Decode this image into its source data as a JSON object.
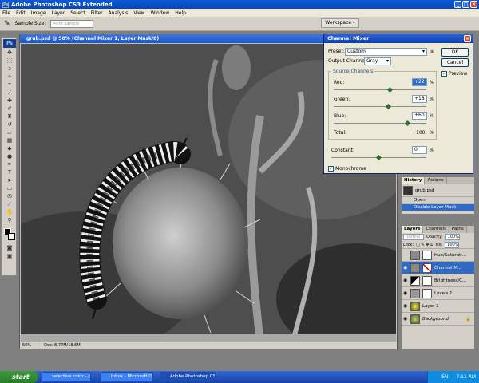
{
  "app": {
    "title": "Adobe Photoshop CS3 Extended"
  },
  "menu": [
    "File",
    "Edit",
    "Image",
    "Layer",
    "Select",
    "Filter",
    "Analysis",
    "View",
    "Window",
    "Help"
  ],
  "options": {
    "sample_size_label": "Sample Size:",
    "sample_size_value": "Point Sample",
    "workspace": "Workspace"
  },
  "document": {
    "title": "grub.psd @ 50% (Channel Mixer 1, Layer Mask/8)",
    "zoom": "50%",
    "doc_size": "Doc: 8.77M/18.6M"
  },
  "mixer": {
    "title": "Channel Mixer",
    "preset_label": "Preset:",
    "preset_value": "Custom",
    "output_label": "Output Channel:",
    "output_value": "Gray",
    "group_label": "Source Channels",
    "red_label": "Red:",
    "red_value": "+22",
    "red_level": 0.61,
    "green_label": "Green:",
    "green_value": "+18",
    "green_level": 0.59,
    "blue_label": "Blue:",
    "blue_value": "+60",
    "blue_level": 0.8,
    "total_label": "Total:",
    "total_value": "+100",
    "pct": "%",
    "constant_label": "Constant:",
    "constant_value": "0",
    "constant_level": 0.5,
    "monochrome_label": "Monochrome",
    "monochrome_checked": true,
    "ok": "OK",
    "cancel": "Cancel",
    "preview": "Preview",
    "preview_checked": true
  },
  "history": {
    "tabs": [
      "History",
      "Actions"
    ],
    "snapshot": "grub.psd",
    "items": [
      "Open",
      "Disable Layer Mask"
    ]
  },
  "layers": {
    "tabs": [
      "Layers",
      "Channels",
      "Paths"
    ],
    "blend_mode": "Normal",
    "opacity_label": "Opacity:",
    "opacity_value": "100%",
    "lock_label": "Lock:",
    "fill_label": "Fill:",
    "fill_value": "100%",
    "rows": [
      {
        "name": "Hue/Saturati...",
        "selected": false
      },
      {
        "name": "Channel M...",
        "selected": true
      },
      {
        "name": "Brightness/C...",
        "selected": false
      },
      {
        "name": "Levels 1",
        "selected": false
      },
      {
        "name": "Layer 1",
        "selected": false
      },
      {
        "name": "Background",
        "selected": false
      }
    ]
  },
  "taskbar": {
    "start": "start",
    "buttons": [
      "selective color - phot...",
      "Inbox - Microsoft Out...",
      "Adobe Photoshop CS..."
    ],
    "lang": "EN",
    "clock": "7:11 AM"
  },
  "colors": {
    "xp_blue": "#0a5ad8",
    "selected": "#316ac5",
    "start_green": "#3c9a3c"
  }
}
